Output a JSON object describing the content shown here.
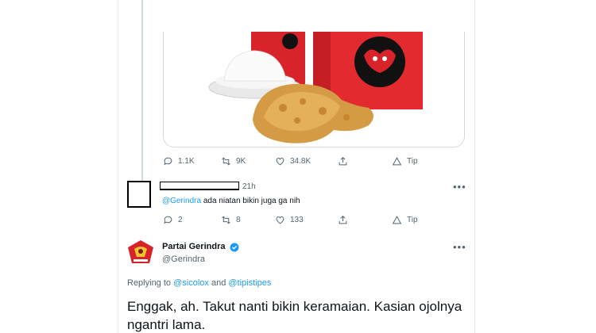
{
  "tweet1": {
    "stats": {
      "replies": "1.1K",
      "retweets": "9K",
      "likes": "34.8K",
      "tip": "Tip"
    }
  },
  "reply": {
    "time": "21h",
    "mention": "@Gerindra",
    "text": "ada niatan bikin juga ga nih",
    "stats": {
      "replies": "2",
      "retweets": "8",
      "likes": "133",
      "tip": "Tip"
    }
  },
  "main_tweet": {
    "author_name": "Partai Gerindra",
    "author_handle": "@Gerindra",
    "replying_prefix": "Replying to",
    "replying_user1": "@sicolox",
    "replying_and": "and",
    "replying_user2": "@tipistipes",
    "line1": "Enggak, ah. Takut nanti bikin keramaian. Kasian ojolnya",
    "line2": "ngantri lama."
  },
  "colors": {
    "accent": "#1d9bf0",
    "muted": "#536471",
    "party_red": "#d8232a"
  }
}
